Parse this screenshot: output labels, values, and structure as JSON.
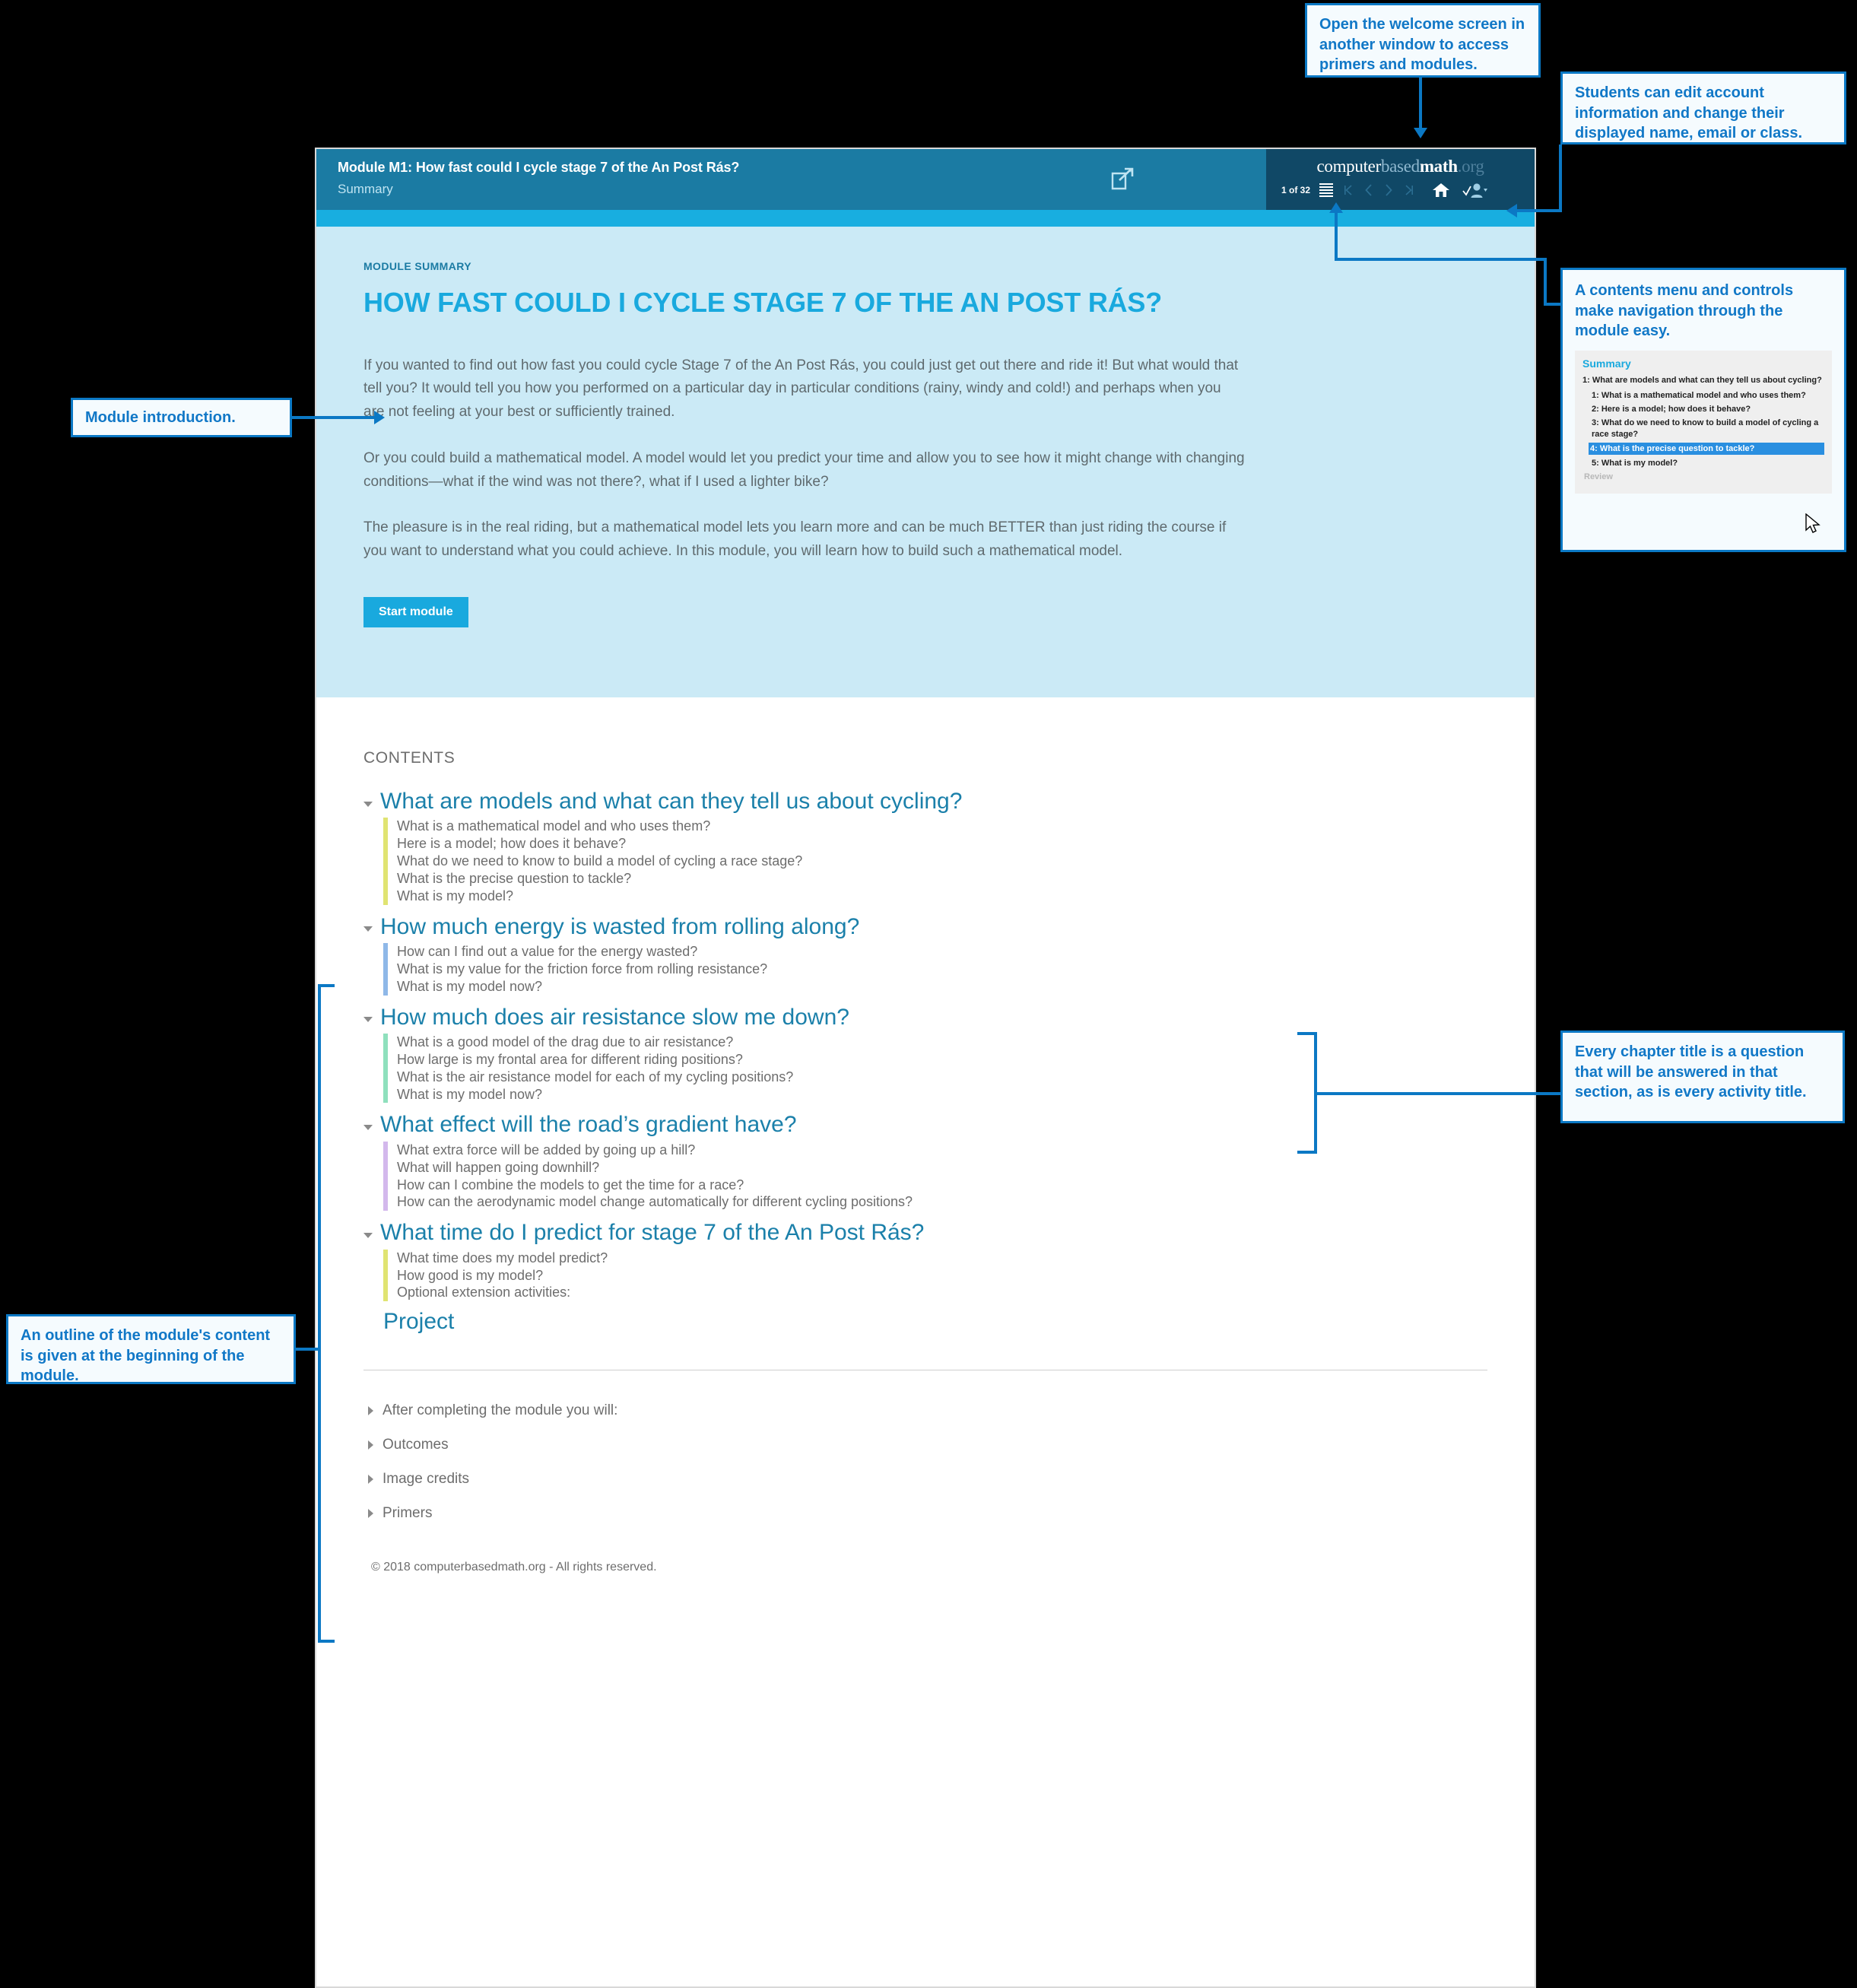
{
  "app": {
    "header": {
      "module_title": "Module M1: How fast could I cycle stage 7 of the An Post Rás?",
      "subtitle": "Summary",
      "popout_icon": "open-in-new-window-icon",
      "brand": {
        "computer": "computer",
        "based": "based",
        "math": "math",
        "org": ".org"
      },
      "nav": {
        "page_counter": "1 of 32",
        "contents_icon": "contents-list-icon",
        "first": "⏮",
        "prev": "‹",
        "next": "›",
        "last": "⏭",
        "home_icon": "home-icon",
        "account_icon": "account-user-icon"
      }
    },
    "summary": {
      "eyebrow": "MODULE SUMMARY",
      "heading": "HOW FAST COULD I CYCLE STAGE 7 OF THE AN POST RÁS?",
      "paragraphs": [
        "If you wanted to find out how fast you could cycle Stage 7 of the An Post Rás, you could just get out there and ride it! But what would that tell you? It would tell you how you performed on a particular day in particular conditions (rainy, windy and cold!) and perhaps when you are not feeling at your best or sufficiently trained.",
        "Or you could build a mathematical model. A model would let you predict your time and allow you to see how it might change with changing conditions—what if the wind was not there?, what if I used a lighter bike?",
        "The pleasure is in the real riding, but a mathematical model lets you learn more and can be much BETTER than just riding the course if you want to understand what you could achieve. In this module, you will learn how to build such a mathematical model."
      ],
      "start_button": "Start module"
    },
    "contents": {
      "label": "CONTENTS",
      "chapters": [
        {
          "title": "What are models and what can they tell us about cycling?",
          "color": "#e0e472",
          "activities": [
            "What is a mathematical model and who uses them?",
            "Here is a model; how does it behave?",
            "What do we need to know to build a model of cycling a race stage?",
            "What is the precise question to tackle?",
            "What is my model?"
          ]
        },
        {
          "title": "How much energy is wasted from rolling along?",
          "color": "#8fb8e8",
          "activities": [
            "How can I find out a value for the energy wasted?",
            "What is my value for the friction force from rolling resistance?",
            "What is my model now?"
          ]
        },
        {
          "title": "How much does air resistance slow me down?",
          "color": "#8fe0bd",
          "activities": [
            "What is a good model of the drag due to air resistance?",
            "How large is my frontal area for different riding positions?",
            "What is the air resistance model for each of my cycling positions?",
            "What is my model now?"
          ]
        },
        {
          "title": "What effect will the road’s gradient have?",
          "color": "#d3b8ec",
          "activities": [
            "What extra force will be added by going up a hill?",
            "What will happen going downhill?",
            "How can I combine the models to get the time for a race?",
            "How can the aerodynamic model change automatically for different cycling positions?"
          ]
        },
        {
          "title": "What time do I predict for stage 7 of the An Post Rás?",
          "color": "#e0e472",
          "activities": [
            "What time does my model predict?",
            "How good is my model?",
            "Optional extension activities:"
          ]
        }
      ],
      "project": "Project"
    },
    "footer_sections": [
      "After completing the module you will:",
      "Outcomes",
      "Image credits",
      "Primers"
    ],
    "copyright": "© 2018 computerbasedmath.org - All rights reserved."
  },
  "annotations": {
    "popout": "Open the welcome screen in another window to access primers and modules.",
    "account": "Students can edit account information and change their displayed name, email or class.",
    "contents_menu": {
      "text": "A contents menu and controls make navigation through the module easy.",
      "thumb": {
        "title": "Summary",
        "chapter": "1: What are models and what can they tell us about cycling?",
        "items": [
          "1: What is a mathematical model and who uses them?",
          "2: Here is a model; how does it behave?",
          "3: What do we need to know to build a model of cycling a race stage?",
          "4: What is the precise question to tackle?",
          "5: What is my model?"
        ],
        "selected_index": 3,
        "review": "Review",
        "cursor_icon": "mouse-pointer-icon"
      }
    },
    "module_intro": "Module introduction.",
    "outline": "An outline of the module's content is given at the beginning of the module.",
    "chapter_title": "Every chapter title is a question that will be answered in that section, as is every activity title."
  },
  "colors": {
    "header_teal": "#1b7ba3",
    "header_navy": "#104866",
    "cyan": "#18aee0",
    "pale_blue": "#cbeaf6",
    "link_blue": "#1b80aa",
    "annotation_blue": "#0b78c4"
  }
}
